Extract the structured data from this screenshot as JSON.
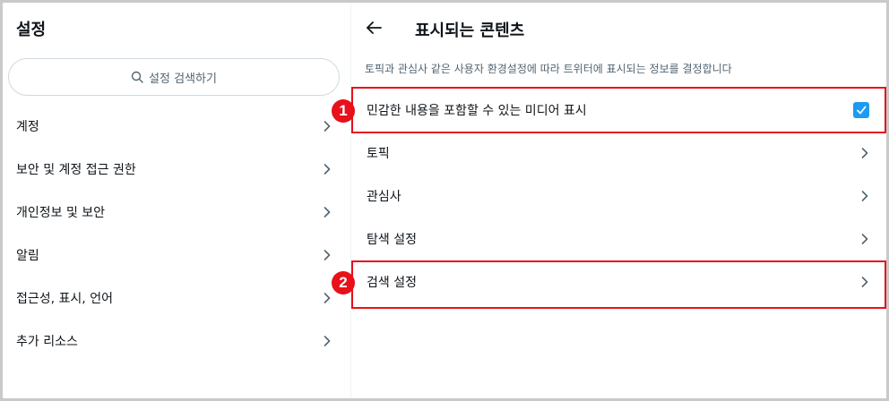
{
  "left": {
    "title": "설정",
    "search_placeholder": "설정 검색하기",
    "items": [
      {
        "label": "계정"
      },
      {
        "label": "보안 및 계정 접근 권한"
      },
      {
        "label": "개인정보 및 보안"
      },
      {
        "label": "알림"
      },
      {
        "label": "접근성, 표시, 언어"
      },
      {
        "label": "추가 리소스"
      }
    ]
  },
  "right": {
    "title": "표시되는 콘텐츠",
    "description": "토픽과 관심사 같은 사용자 환경설정에 따라 트위터에 표시되는 정보를 결정합니다",
    "items": [
      {
        "label": "민감한 내용을 포함할 수 있는 미디어 표시",
        "checked": true
      },
      {
        "label": "토픽"
      },
      {
        "label": "관심사"
      },
      {
        "label": "탐색 설정"
      },
      {
        "label": "검색 설정"
      }
    ]
  },
  "annotations": {
    "badge_1": "1",
    "badge_2": "2",
    "color": "#e8101a"
  },
  "colors": {
    "accent": "#1d9bf0",
    "text": "#0f1419",
    "secondary_text": "#536471"
  },
  "icons": {
    "back": "arrow-left-icon",
    "search": "search-icon",
    "chevron": "chevron-right-icon",
    "checkbox": "checkbox-checked-icon"
  }
}
